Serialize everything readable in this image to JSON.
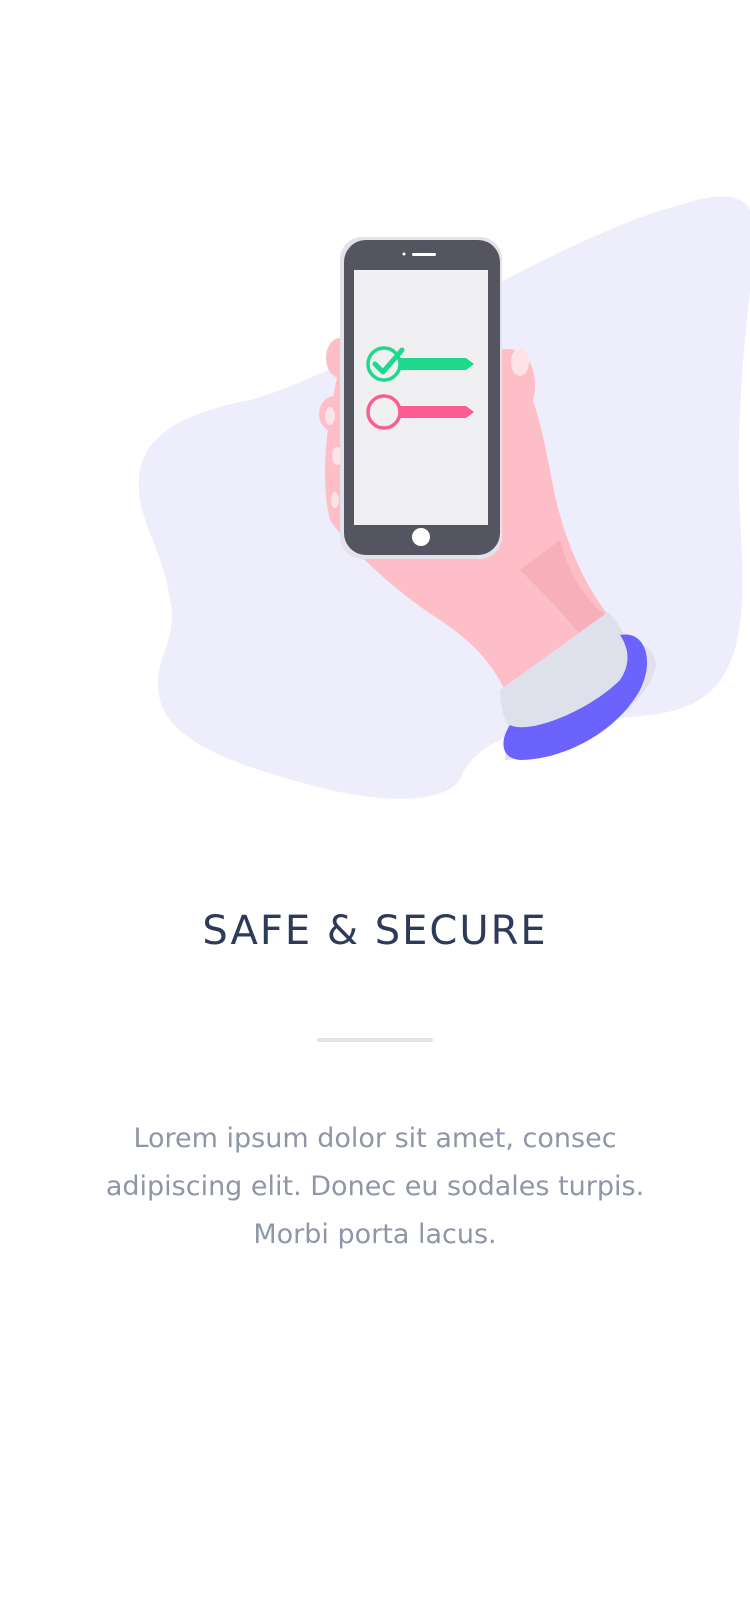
{
  "onboarding": {
    "title": "SAFE & SECURE",
    "description": "Lorem ipsum dolor sit amet, consec adipiscing elit. Donec eu sodales turpis. Morbi porta lacus."
  },
  "colors": {
    "background": "#ffffff",
    "blob": "#eeedfc",
    "title": "#2e3a59",
    "body_text": "#8f96a8",
    "divider": "#e3e3e6",
    "phone_frame": "#545561",
    "phone_screen": "#f0eff2",
    "check_green": "#1ed98d",
    "pending_pink": "#fc5c91",
    "skin": "#fdbec7",
    "sleeve": "#dee1ec",
    "cuff": "#6c63ff"
  },
  "illustration": {
    "icons": [
      "hand-holding-phone-icon",
      "checkmark-circle-icon",
      "empty-circle-icon"
    ]
  }
}
